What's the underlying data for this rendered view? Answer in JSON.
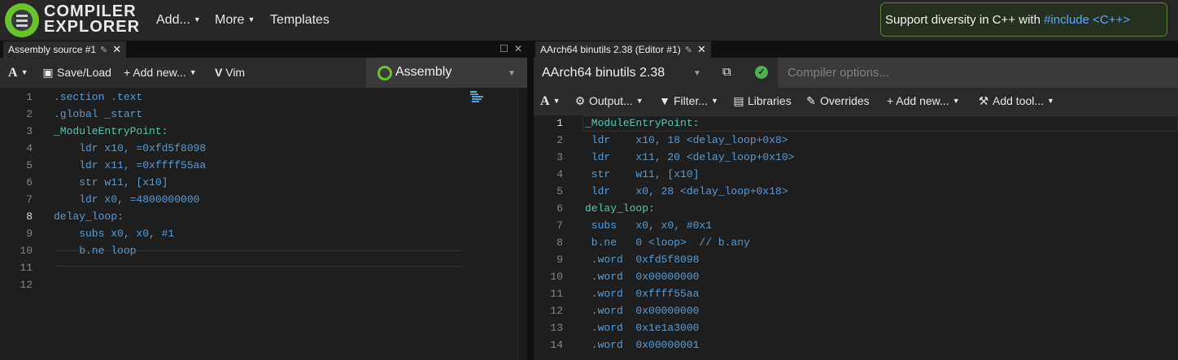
{
  "header": {
    "logo_line1": "COMPILER",
    "logo_line2": "EXPLORER",
    "nav": [
      "Add...",
      "More",
      "Templates"
    ],
    "promo_prefix": "Support diversity in C++ with ",
    "promo_link": "#include <C++>"
  },
  "left_pane": {
    "tab_title": "Assembly source #1",
    "toolbar": {
      "font_btn": "A",
      "save_load": "Save/Load",
      "add_new": "Add new...",
      "vim": "Vim",
      "language": "Assembly"
    },
    "lines": [
      ".section .text",
      ".global _start",
      "_ModuleEntryPoint:",
      "    ldr x10, =0xfd5f8098",
      "    ldr x11, =0xffff55aa",
      "    str w11, [x10]",
      "    ldr x0, =4800000000",
      "delay_loop:",
      "    subs x0, x0, #1",
      "    b.ne loop",
      "",
      ""
    ],
    "line_numbers": [
      "1",
      "2",
      "3",
      "4",
      "5",
      "6",
      "7",
      "8",
      "9",
      "10",
      "11",
      "12"
    ]
  },
  "right_pane": {
    "tab_title": "AArch64 binutils 2.38 (Editor #1)",
    "compiler": "AArch64 binutils 2.38",
    "options_placeholder": "Compiler options...",
    "toolbar": {
      "font_btn": "A",
      "output": "Output...",
      "filter": "Filter...",
      "libraries": "Libraries",
      "overrides": "Overrides",
      "add_new": "Add new...",
      "add_tool": "Add tool..."
    },
    "line_numbers": [
      "1",
      "2",
      "3",
      "4",
      "5",
      "6",
      "7",
      "8",
      "9",
      "10",
      "11",
      "12",
      "13",
      "14"
    ],
    "asm_lines": [
      "_ModuleEntryPoint:",
      " ldr    x10, 18 <delay_loop+0x8>",
      " ldr    x11, 20 <delay_loop+0x10>",
      " str    w11, [x10]",
      " ldr    x0, 28 <delay_loop+0x18>",
      "delay_loop:",
      " subs   x0, x0, #0x1",
      " b.ne   0 <loop>  // b.any",
      " .word  0xfd5f8098",
      " .word  0x00000000",
      " .word  0xffff55aa",
      " .word  0x00000000",
      " .word  0x1e1a3000",
      " .word  0x00000001"
    ]
  },
  "colors": {
    "accent_green": "#67c52a",
    "link_blue": "#58a6ff"
  }
}
